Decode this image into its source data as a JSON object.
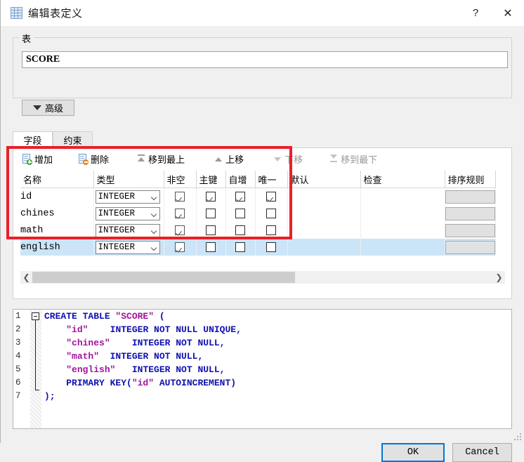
{
  "window": {
    "title": "编辑表定义",
    "title_icon": "table-grid-icon",
    "help_label": "?",
    "close_label": "✕"
  },
  "table_group": {
    "legend": "表",
    "name_value": "SCORE",
    "name_placeholder": "",
    "advanced_label": "高级",
    "advanced_caret": "▼"
  },
  "tabs": [
    {
      "label": "字段",
      "active": true
    },
    {
      "label": "约束",
      "active": false
    }
  ],
  "toolbar": [
    {
      "label": "增加",
      "icon": "document-add-icon",
      "enabled": true
    },
    {
      "label": "删除",
      "icon": "document-remove-icon",
      "enabled": true
    },
    {
      "label": "移到最上",
      "icon": "move-to-top-icon",
      "enabled": true
    },
    {
      "label": "上移",
      "icon": "move-up-icon",
      "enabled": true
    },
    {
      "label": "下移",
      "icon": "move-down-icon",
      "enabled": false
    },
    {
      "label": "移到最下",
      "icon": "move-to-bottom-icon",
      "enabled": false
    }
  ],
  "grid": {
    "columns": [
      "名称",
      "类型",
      "非空",
      "主键",
      "自增",
      "唯一",
      "默认",
      "检查",
      "排序规则"
    ],
    "rows": [
      {
        "name": "id",
        "type": "INTEGER",
        "notnull": true,
        "pk": true,
        "ai": true,
        "unique": true,
        "default": "",
        "check": "",
        "collate": "",
        "selected": false
      },
      {
        "name": "chines",
        "type": "INTEGER",
        "notnull": true,
        "pk": false,
        "ai": false,
        "unique": false,
        "default": "",
        "check": "",
        "collate": "",
        "selected": false
      },
      {
        "name": "math",
        "type": "INTEGER",
        "notnull": true,
        "pk": false,
        "ai": false,
        "unique": false,
        "default": "",
        "check": "",
        "collate": "",
        "selected": false
      },
      {
        "name": "english",
        "type": "INTEGER",
        "notnull": true,
        "pk": false,
        "ai": false,
        "unique": false,
        "default": "",
        "check": "",
        "collate": "",
        "selected": true
      }
    ],
    "selected_row_color": "#cce4f7"
  },
  "hscrollbar": {
    "left_arrow": "❮",
    "right_arrow": "❯",
    "thumb_percent": 57
  },
  "sql": {
    "line_numbers": [
      "1",
      "2",
      "3",
      "4",
      "5",
      "6",
      "7"
    ],
    "lines": [
      [
        {
          "t": "CREATE TABLE ",
          "c": "kw"
        },
        {
          "t": "\"SCORE\"",
          "c": "str"
        },
        {
          "t": " (",
          "c": "kw"
        }
      ],
      [
        {
          "t": "    ",
          "c": "pl"
        },
        {
          "t": "\"id\"",
          "c": "str"
        },
        {
          "t": "    INTEGER NOT NULL UNIQUE,",
          "c": "kw"
        }
      ],
      [
        {
          "t": "    ",
          "c": "pl"
        },
        {
          "t": "\"chines\"",
          "c": "str"
        },
        {
          "t": "    INTEGER NOT NULL,",
          "c": "kw"
        }
      ],
      [
        {
          "t": "    ",
          "c": "pl"
        },
        {
          "t": "\"math\"",
          "c": "str"
        },
        {
          "t": "  INTEGER NOT NULL,",
          "c": "kw"
        }
      ],
      [
        {
          "t": "    ",
          "c": "pl"
        },
        {
          "t": "\"english\"",
          "c": "str"
        },
        {
          "t": "   INTEGER NOT NULL,",
          "c": "kw"
        }
      ],
      [
        {
          "t": "    PRIMARY KEY(",
          "c": "kw"
        },
        {
          "t": "\"id\"",
          "c": "str"
        },
        {
          "t": " AUTOINCREMENT)",
          "c": "kw"
        }
      ],
      [
        {
          "t": ");",
          "c": "kw"
        }
      ]
    ]
  },
  "footer": {
    "ok_label": "OK",
    "cancel_label": "Cancel",
    "focus_color": "#0078d7"
  },
  "annotation": {
    "color": "#e8202a",
    "shape": "rectangle"
  }
}
